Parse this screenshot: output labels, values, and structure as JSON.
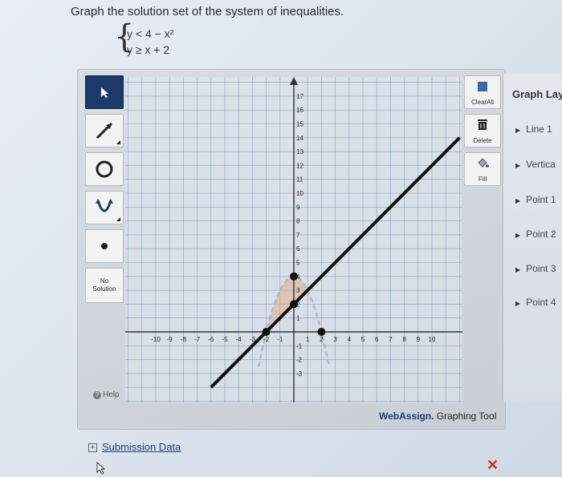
{
  "question": {
    "prompt": "Graph the solution set of the system of inequalities.",
    "brace": "{",
    "ineq1": "y < 4 − x²",
    "ineq2": "y ≥ x + 2"
  },
  "toolbar": {
    "items": [
      "pointer-tool",
      "line-tool",
      "circle-tool",
      "parabola-tool",
      "point-tool",
      "no-solution-tool"
    ],
    "no_solution_label_1": "No",
    "no_solution_label_2": "Solution",
    "help_label": "Help"
  },
  "rightbar": {
    "clear_all_label": "ClearAll",
    "delete_label": "Delete",
    "fill_label": "Fill"
  },
  "graph": {
    "x_ticks": [
      -10,
      -9,
      -8,
      -7,
      -6,
      -5,
      -4,
      -3,
      -2,
      -1,
      1,
      2,
      3,
      4,
      5,
      6,
      7,
      8,
      9,
      10
    ],
    "y_ticks": [
      17,
      16,
      15,
      14,
      13,
      12,
      11,
      10,
      9,
      8,
      7,
      6,
      5,
      4,
      3,
      2,
      1,
      -1,
      -2,
      -3
    ],
    "line": {
      "equation": "y = x + 2",
      "points": [
        [
          -2,
          0
        ],
        [
          0,
          2
        ]
      ]
    },
    "parabola": {
      "equation": "y = 4 - x^2",
      "vertex": [
        0,
        4
      ],
      "point": [
        2,
        0
      ]
    }
  },
  "brand": {
    "name": "WebAssign.",
    "suffix": " Graphing Tool"
  },
  "layers": {
    "title": "Graph Lay",
    "items": [
      "Line 1",
      "Vertica",
      "Point 1",
      "Point 2",
      "Point 3",
      "Point 4"
    ]
  },
  "submission": {
    "label": "Submission Data"
  },
  "colors": {
    "accent": "#1e3a6b",
    "error": "#c03a1d",
    "grid": "#6f8aa8",
    "line": "#111111"
  }
}
